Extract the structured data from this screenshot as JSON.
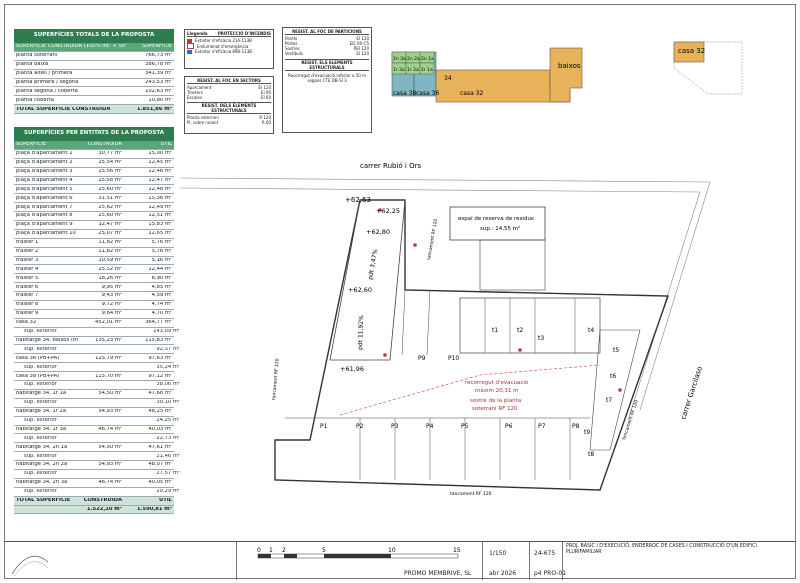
{
  "totals": {
    "title": "SUPERFÍCIES TOTALS DE LA PROPOSTA",
    "col_superficie": "SUPERFÍCIE CONSTRUÏDA (100% int. + 50% ext. vol.)",
    "col_value": "SUPERFÍCIE",
    "rows": [
      {
        "label": "planta soterrani",
        "value": "766,73 m²"
      },
      {
        "label": "planta baixa",
        "value": "386,78 m²"
      },
      {
        "label": "planta altell / primera",
        "value": "341,39 m²"
      },
      {
        "label": "planta primera / segona",
        "value": "243,53 m²"
      },
      {
        "label": "planta segona / coberta",
        "value": "102,63 m²"
      },
      {
        "label": "planta coberta",
        "value": "10,80 m²"
      }
    ],
    "total_label": "TOTAL SUPERFÍCIE CONSTRUÏDA",
    "total_value": "1.851,86 m²"
  },
  "entities": {
    "title": "SUPERFÍCIES PER ENTITATS DE LA PROPOSTA",
    "col1": "SUPERFÍCIE",
    "col2": "CONSTRUÏDA",
    "col3": "ÚTIL",
    "rows": [
      {
        "label": "plaça d'aparcament 1",
        "c": "30,77 m²",
        "u": "15,00 m²"
      },
      {
        "label": "plaça d'aparcament 2",
        "c": "25,54 m²",
        "u": "12,45 m²"
      },
      {
        "label": "plaça d'aparcament 3",
        "c": "25,56 m²",
        "u": "12,46 m²"
      },
      {
        "label": "plaça d'aparcament 4",
        "c": "25,58 m²",
        "u": "12,47 m²"
      },
      {
        "label": "plaça d'aparcament 5",
        "c": "25,60 m²",
        "u": "12,48 m²"
      },
      {
        "label": "plaça d'aparcament 6",
        "c": "31,51 m²",
        "u": "15,36 m²"
      },
      {
        "label": "plaça d'aparcament 7",
        "c": "25,62 m²",
        "u": "12,49 m²"
      },
      {
        "label": "plaça d'aparcament 8",
        "c": "25,60 m²",
        "u": "12,51 m²"
      },
      {
        "label": "plaça d'aparcament 9",
        "c": "32,47 m²",
        "u": "15,83 m²"
      },
      {
        "label": "plaça d'aparcament 10",
        "c": "25,07 m²",
        "u": "12,65 m²"
      },
      {
        "label": "traster 1",
        "c": "11,82 m²",
        "u": "5,76 m²"
      },
      {
        "label": "traster 2",
        "c": "11,82 m²",
        "u": "5,76 m²"
      },
      {
        "label": "traster 3",
        "c": "10,59 m²",
        "u": "5,16 m²"
      },
      {
        "label": "traster 4",
        "c": "25,52 m²",
        "u": "12,44 m²"
      },
      {
        "label": "traster 5",
        "c": "18,26 m²",
        "u": "8,90 m²"
      },
      {
        "label": "traster 6",
        "c": "9,95 m²",
        "u": "4,85 m²"
      },
      {
        "label": "traster 7",
        "c": "9,43 m²",
        "u": "4,59 m²"
      },
      {
        "label": "traster 8",
        "c": "9,72 m²",
        "u": "4,74 m²"
      },
      {
        "label": "traster 9",
        "c": "9,64 m²",
        "u": "4,70 m²"
      },
      {
        "label": "casa 32",
        "c": "452,01 m²",
        "u": "364,77 m²"
      },
      {
        "label": "sup. exterior",
        "c": "",
        "u": "143,09 m²",
        "sub": true
      },
      {
        "label": "habitatge 34, baixos (triplex)",
        "c": "135,23 m²",
        "u": "115,83 m²"
      },
      {
        "label": "sup. exterior",
        "c": "",
        "u": "92,37 m²",
        "sub": true
      },
      {
        "label": "casa 36 (PB+PA)",
        "c": "115,79 m²",
        "u": "97,63 m²"
      },
      {
        "label": "sup. exterior",
        "c": "",
        "u": "35,24 m²",
        "sub": true
      },
      {
        "label": "casa 38 (PB+PA)",
        "c": "115,70 m²",
        "u": "97,12 m²"
      },
      {
        "label": "sup. exterior",
        "c": "",
        "u": "38,06 m²",
        "sub": true
      },
      {
        "label": "habitatge 34, 1r 1a",
        "c": "54,50 m²",
        "u": "47,68 m²"
      },
      {
        "label": "sup. exterior",
        "c": "",
        "u": "30,10 m²",
        "sub": true
      },
      {
        "label": "habitatge 34, 1r 2a",
        "c": "54,93 m²",
        "u": "48,25 m²"
      },
      {
        "label": "sup. exterior",
        "c": "",
        "u": "24,25 m²",
        "sub": true
      },
      {
        "label": "habitatge 34, 1r 3a",
        "c": "46,74 m²",
        "u": "40,03 m²"
      },
      {
        "label": "sup. exterior",
        "c": "",
        "u": "22,73 m²",
        "sub": true
      },
      {
        "label": "habitatge 34, 2n 1a",
        "c": "54,50 m²",
        "u": "47,61 m²"
      },
      {
        "label": "sup. exterior",
        "c": "",
        "u": "21,46 m²",
        "sub": true
      },
      {
        "label": "habitatge 34, 2n 2a",
        "c": "54,93 m²",
        "u": "48,07 m²"
      },
      {
        "label": "sup. exterior",
        "c": "",
        "u": "27,57 m²",
        "sub": true
      },
      {
        "label": "habitatge 34, 2n 3a",
        "c": "46,74 m²",
        "u": "40,05 m²"
      },
      {
        "label": "sup. exterior",
        "c": "",
        "u": "20,29 m²",
        "sub": true
      }
    ],
    "total_label": "TOTAL SUPERFÍCIE",
    "total_c_hdr": "CONSTRUÏDA",
    "total_u_hdr": "ÚTIL",
    "total_c": "1.522,10 m²",
    "total_u": "1.590,81 m²"
  },
  "legend": {
    "col1": "Llegenda",
    "col2": "PROTECCIÓ D'INCENDIS",
    "items": [
      "Extintor d'eficàcia 21A-113B",
      "Enllumenat d'emergència",
      "Extintor d'eficàcia 89B-113B"
    ]
  },
  "bcn": {
    "title": "RESIST. AL FOC EN SECTORS",
    "rows": [
      "Aparcament",
      "Trasters",
      "Escales"
    ],
    "vals": [
      "EI 120",
      "EI 90",
      "EI 60"
    ],
    "sub_title": "RESIST. DELS ELEMENTS ESTRUCTURALS",
    "sub_rows": [
      "Planta soterrani",
      "Pl. sobre rasant"
    ],
    "sub_vals": [
      "R 120",
      "R 60"
    ]
  },
  "cte": {
    "title": "RESIST. AL FOC DE PARTICIONS",
    "rows": [
      "Parets",
      "Portes",
      "Sostres",
      "Vestíbuls"
    ],
    "vals": [
      "EI 120",
      "EI2 60-C5",
      "REI 120",
      "EI 120"
    ],
    "sub_title": "RESIST. ELS ELEMENTS ESTRUCTURALS",
    "note": "Recorregut d'evacuació inferior a 50 m segons CTE DB-SI 3"
  },
  "keyplan": {
    "casa32": "casa 32",
    "baixos": "baixos",
    "casa38": "casa 38",
    "casa36": "casa 36",
    "casa32b": "casa 32",
    "n34": "34",
    "units": [
      "2n 3a",
      "2n 2a",
      "2n 1a",
      "1r 3a",
      "1r 2a",
      "1r 1a"
    ]
  },
  "plan": {
    "street_top": "carrer Rubió i Ors",
    "street_right": "carrer Garcilaso",
    "lev1": "+62,63",
    "lev2": "+62,25",
    "lev3": "+62,80",
    "lev4": "+62,60",
    "lev5": "+61,96",
    "ramp1": "pdt 3,47%",
    "ramp2": "pdt 11,92%",
    "waste": "espai de reserva de residus",
    "waste_sup": "sup.: 14,55 m²",
    "evac": "recorregut d'evacuació",
    "evac_max": "màxim 20,31 m",
    "ceiling": "sostre de la planta",
    "ceiling2": "soterrani RF 120",
    "walls": [
      "tancament RF 120",
      "tancament RF 120",
      "tancament RF 120",
      "tancament RF 120"
    ],
    "places_top": [
      "P9",
      "P10"
    ],
    "places_bottom": [
      "P1",
      "P2",
      "P3",
      "P4",
      "P5",
      "P6",
      "P7",
      "P8"
    ],
    "stores": [
      "t1",
      "t2",
      "t3",
      "t4",
      "t5",
      "t6",
      "t7",
      "t8",
      "t9"
    ]
  },
  "titleblock": {
    "scale_ticks": [
      "0",
      "1",
      "2",
      "5",
      "10",
      "15"
    ],
    "scale": "1/150",
    "ref": "24-675",
    "project": "PROJ. BÀSIC I D'EXECUCIÓ, ENDERROC DE CASES I CONSTRUCCIÓ D'UN EDIFICI PLURIFAMILIAR",
    "client": "PROMO MEMBRIVE, SL",
    "date": "abr 2026",
    "sheet": "p4 PRO-01"
  }
}
